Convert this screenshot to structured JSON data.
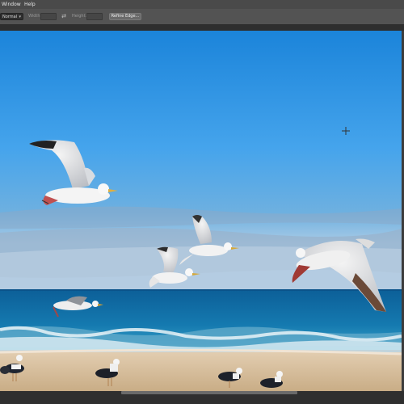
{
  "menubar": {
    "items": [
      {
        "label": "Window"
      },
      {
        "label": "Help"
      }
    ]
  },
  "options": {
    "style_value": "Normal",
    "width_label": "Width:",
    "height_label": "Height:",
    "refine_button": "Refine Edge..."
  },
  "colors": {
    "sky_top": "#1d86dc",
    "sky_bottom": "#7fb7e2",
    "sea": "#126aa0",
    "sand": "#d9c2a2"
  }
}
